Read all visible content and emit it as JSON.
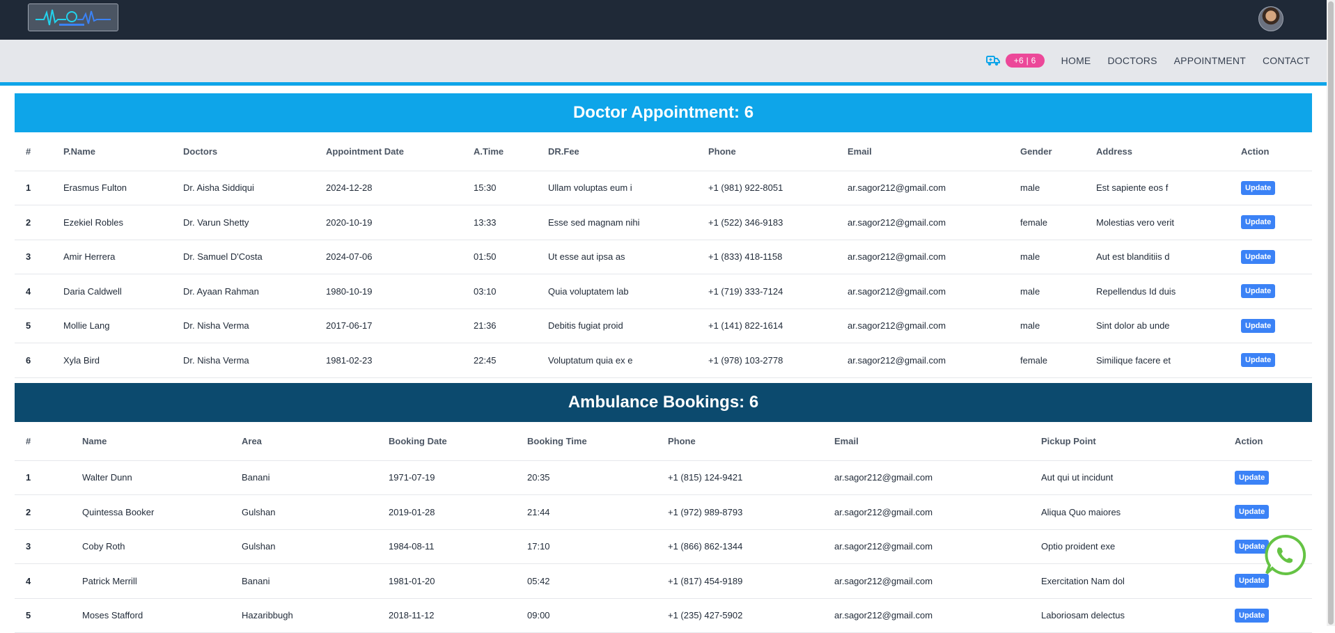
{
  "topbar": {
    "logo_icon": "heartbeat-logo-icon",
    "avatar_icon": "user-avatar"
  },
  "nav": {
    "ambulance_icon": "ambulance-icon",
    "badge": "+6 | 6",
    "links": [
      "HOME",
      "DOCTORS",
      "APPOINTMENT",
      "CONTACT"
    ]
  },
  "doctor_section": {
    "title": "Doctor Appointment: 6",
    "headers": [
      "#",
      "P.Name",
      "Doctors",
      "Appointment Date",
      "A.Time",
      "DR.Fee",
      "Phone",
      "Email",
      "Gender",
      "Address",
      "Action"
    ],
    "rows": [
      [
        "1",
        "Erasmus Fulton",
        "Dr. Aisha Siddiqui",
        "2024-12-28",
        "15:30",
        "Ullam voluptas eum i",
        "+1 (981) 922-8051",
        "ar.sagor212@gmail.com",
        "male",
        "Est sapiente eos f"
      ],
      [
        "2",
        "Ezekiel Robles",
        "Dr. Varun Shetty",
        "2020-10-19",
        "13:33",
        "Esse sed magnam nihi",
        "+1 (522) 346-9183",
        "ar.sagor212@gmail.com",
        "female",
        "Molestias vero verit"
      ],
      [
        "3",
        "Amir Herrera",
        "Dr. Samuel D'Costa",
        "2024-07-06",
        "01:50",
        "Ut esse aut ipsa as",
        "+1 (833) 418-1158",
        "ar.sagor212@gmail.com",
        "male",
        "Aut est blanditiis d"
      ],
      [
        "4",
        "Daria Caldwell",
        "Dr. Ayaan Rahman",
        "1980-10-19",
        "03:10",
        "Quia voluptatem lab",
        "+1 (719) 333-7124",
        "ar.sagor212@gmail.com",
        "male",
        "Repellendus Id duis"
      ],
      [
        "5",
        "Mollie Lang",
        "Dr. Nisha Verma",
        "2017-06-17",
        "21:36",
        "Debitis fugiat proid",
        "+1 (141) 822-1614",
        "ar.sagor212@gmail.com",
        "male",
        "Sint dolor ab unde"
      ],
      [
        "6",
        "Xyla Bird",
        "Dr. Nisha Verma",
        "1981-02-23",
        "22:45",
        "Voluptatum quia ex e",
        "+1 (978) 103-2778",
        "ar.sagor212@gmail.com",
        "female",
        "Similique facere et"
      ]
    ],
    "action_label": "Update"
  },
  "ambulance_section": {
    "title": "Ambulance Bookings: 6",
    "headers": [
      "#",
      "Name",
      "Area",
      "Booking Date",
      "Booking Time",
      "Phone",
      "Email",
      "Pickup Point",
      "Action"
    ],
    "rows": [
      [
        "1",
        "Walter Dunn",
        "Banani",
        "1971-07-19",
        "20:35",
        "+1 (815) 124-9421",
        "ar.sagor212@gmail.com",
        "Aut qui ut incidunt"
      ],
      [
        "2",
        "Quintessa Booker",
        "Gulshan",
        "2019-01-28",
        "21:44",
        "+1 (972) 989-8793",
        "ar.sagor212@gmail.com",
        "Aliqua Quo maiores"
      ],
      [
        "3",
        "Coby Roth",
        "Gulshan",
        "1984-08-11",
        "17:10",
        "+1 (866) 862-1344",
        "ar.sagor212@gmail.com",
        "Optio proident exe"
      ],
      [
        "4",
        "Patrick Merrill",
        "Banani",
        "1981-01-20",
        "05:42",
        "+1 (817) 454-9189",
        "ar.sagor212@gmail.com",
        "Exercitation Nam dol"
      ],
      [
        "5",
        "Moses Stafford",
        "Hazaribbugh",
        "2018-11-12",
        "09:00",
        "+1 (235) 427-5902",
        "ar.sagor212@gmail.com",
        "Laboriosam delectus"
      ]
    ],
    "action_label": "Update"
  },
  "floating": {
    "whatsapp_icon": "whatsapp-icon"
  },
  "colors": {
    "topbar": "#1f2937",
    "navbar": "#e5e7eb",
    "accent": "#0ea5e9",
    "ambulance_header": "#0c4a6e",
    "badge": "#ec4899",
    "button": "#3b82f6",
    "whatsapp": "#65c344"
  }
}
